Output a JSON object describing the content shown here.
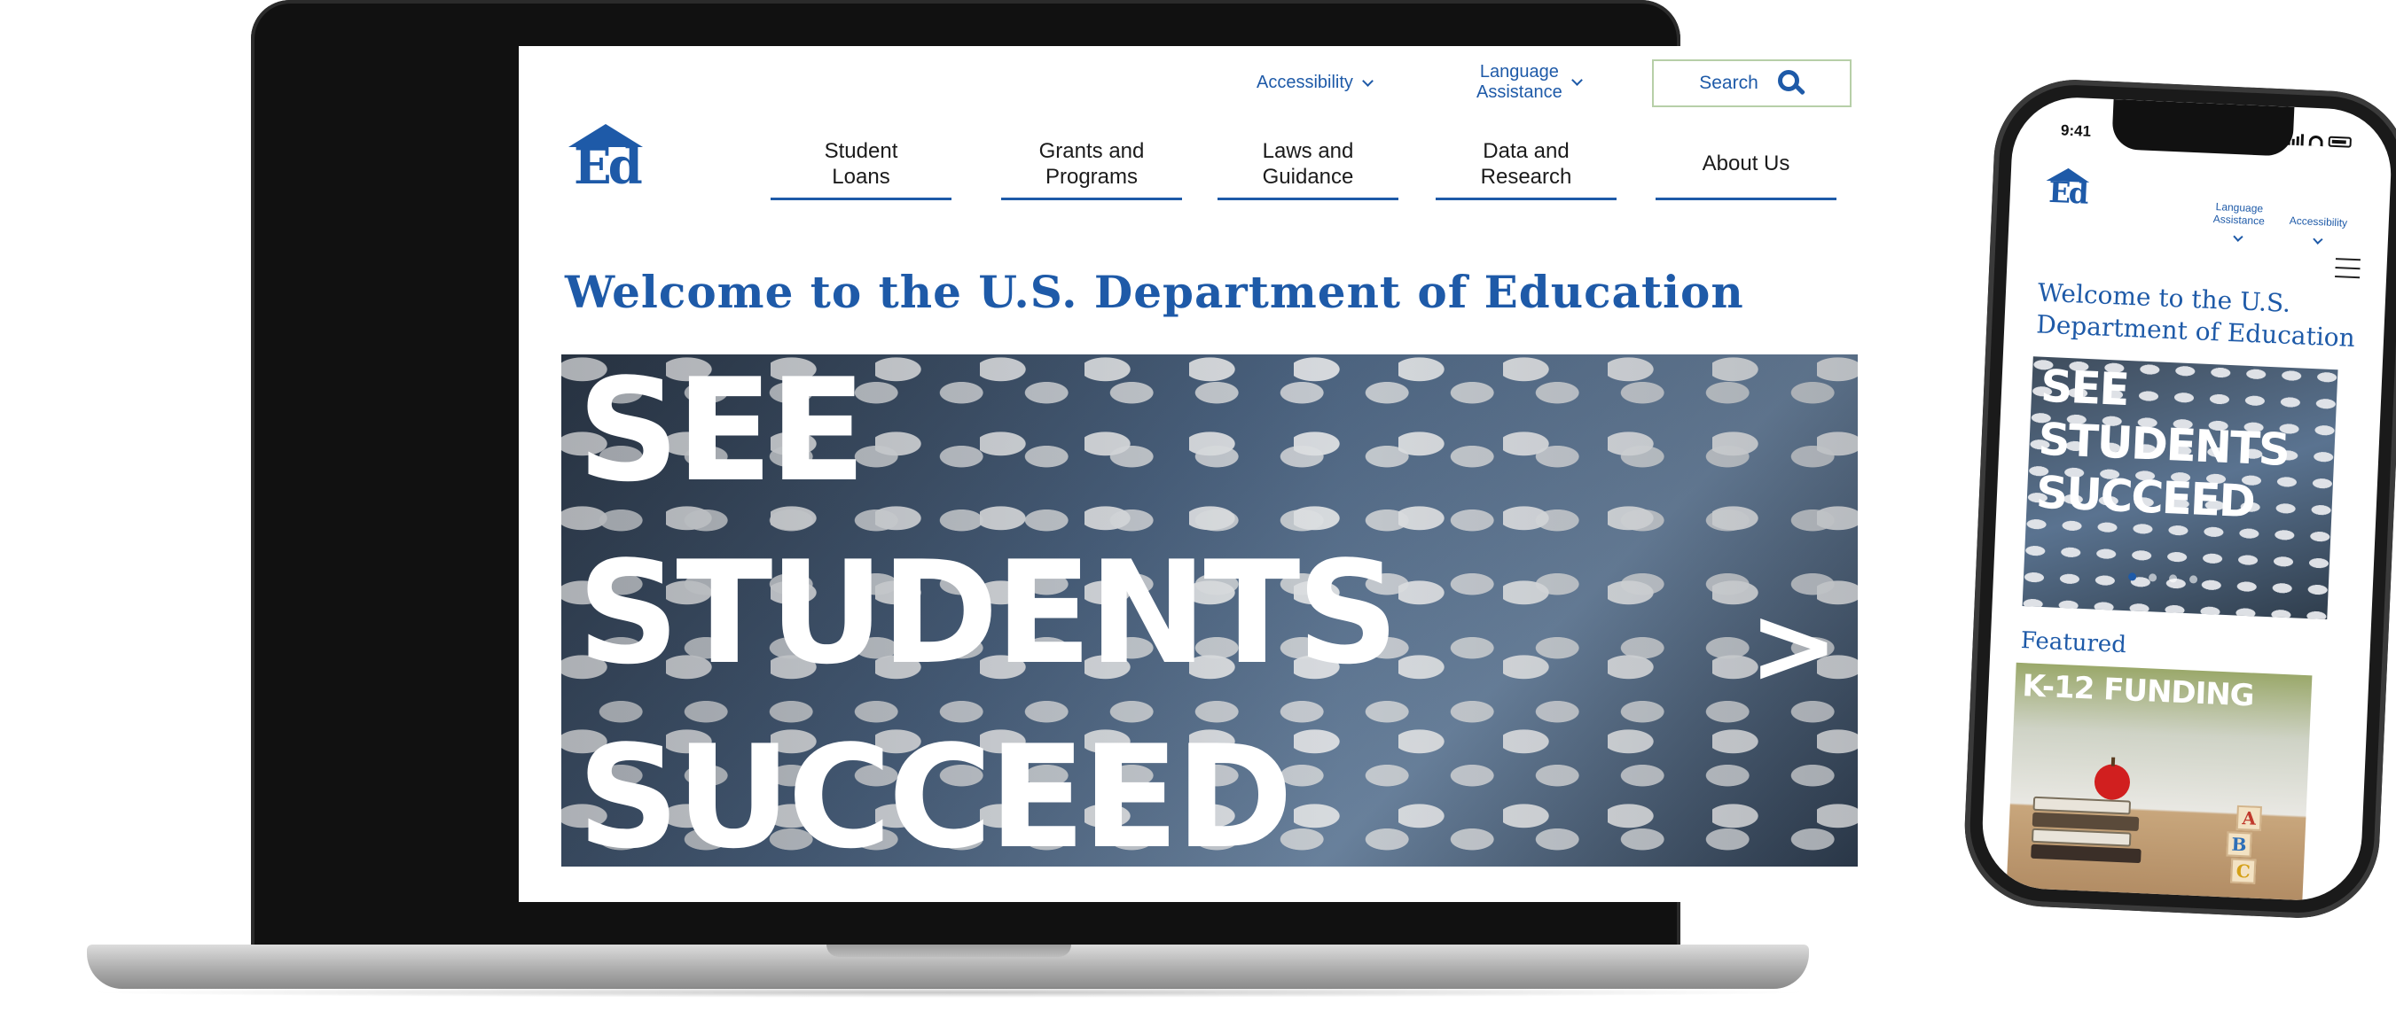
{
  "desktop": {
    "utility": {
      "accessibility": "Accessibility",
      "language": "Language\nAssistance",
      "search": "Search"
    },
    "logo": {
      "letters": "Ed"
    },
    "nav": [
      {
        "label": "Student\nLoans"
      },
      {
        "label": "Grants and\nPrograms"
      },
      {
        "label": "Laws and\nGuidance"
      },
      {
        "label": "Data and\nResearch"
      },
      {
        "label": "About Us"
      }
    ],
    "welcome": "Welcome to the U.S. Department of Education",
    "hero": {
      "lines": [
        "SEE",
        "STUDENTS",
        "SUCCEED"
      ],
      "arrow": ">"
    }
  },
  "mobile": {
    "time": "9:41",
    "utility": {
      "language": "Language\nAssistance",
      "accessibility": "Accessibility"
    },
    "logo": {
      "letters": "Ed"
    },
    "welcome": "Welcome to the U.S.\nDepartment of Education",
    "hero": {
      "lines": [
        "SEE",
        "STUDENTS",
        "SUCCEED"
      ]
    },
    "carousel_active_slide": 1,
    "featured_heading": "Featured",
    "card_title": "K-12 FUNDING",
    "blocks": [
      "A",
      "B",
      "C"
    ]
  },
  "colors": {
    "brand_blue": "#1e5aa8",
    "search_border": "#b7cfa8"
  }
}
